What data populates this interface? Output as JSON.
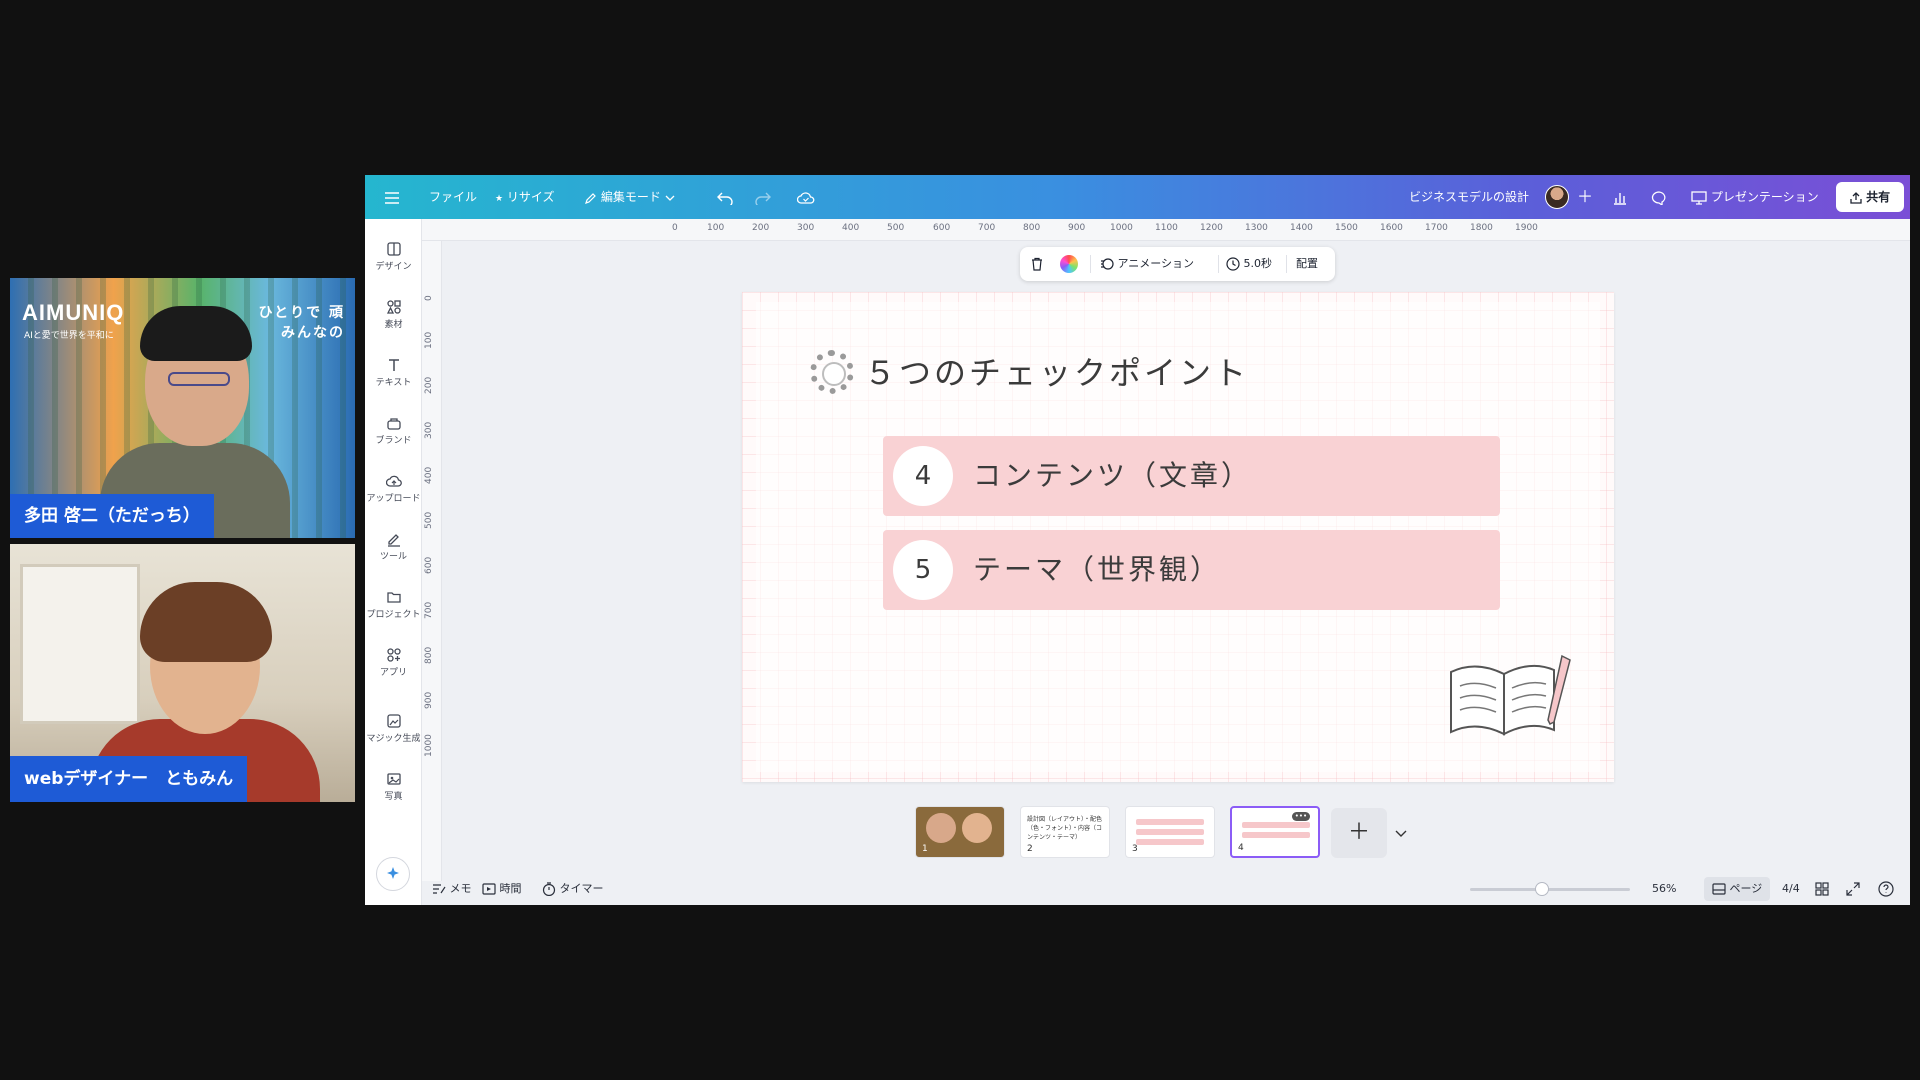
{
  "participants": [
    {
      "name": "多田 啓二（ただっち）",
      "background_brand": "AIMUNIQ",
      "background_brand_sub": "AIと愛で世界を平和に",
      "background_catch_line1": "ひとりで 頑",
      "background_catch_line2": "みんなの"
    },
    {
      "name": "webデザイナー　ともみん"
    }
  ],
  "topbar": {
    "file": "ファイル",
    "resize": "リサイズ",
    "edit_mode": "編集モード",
    "doc_title": "ビジネスモデルの設計",
    "present": "プレゼンテーション",
    "share": "共有"
  },
  "sidebar": {
    "items": [
      {
        "label": "デザイン",
        "icon": "design-icon"
      },
      {
        "label": "素材",
        "icon": "elements-icon"
      },
      {
        "label": "テキスト",
        "icon": "text-icon"
      },
      {
        "label": "ブランド",
        "icon": "brand-icon"
      },
      {
        "label": "アップロード",
        "icon": "upload-icon"
      },
      {
        "label": "ツール",
        "icon": "draw-icon"
      },
      {
        "label": "プロジェクト",
        "icon": "folder-icon"
      },
      {
        "label": "アプリ",
        "icon": "apps-icon"
      },
      {
        "label": "マジック生成",
        "icon": "magic-media-icon"
      },
      {
        "label": "写真",
        "icon": "photo-icon"
      }
    ]
  },
  "ruler": {
    "top": [
      "0",
      "100",
      "200",
      "300",
      "400",
      "500",
      "600",
      "700",
      "800",
      "900",
      "1000",
      "1100",
      "1200",
      "1300",
      "1400",
      "1500",
      "1600",
      "1700",
      "1800",
      "1900"
    ],
    "left": [
      "0",
      "100",
      "200",
      "300",
      "400",
      "500",
      "600",
      "700",
      "800",
      "900",
      "1000"
    ]
  },
  "element_toolbar": {
    "animation": "アニメーション",
    "duration": "5.0秒",
    "arrange": "配置"
  },
  "slide": {
    "title": "５つのチェックポイント",
    "points": [
      {
        "num": "4",
        "label": "コンテンツ（文章）"
      },
      {
        "num": "5",
        "label": "テーマ（世界観）"
      }
    ],
    "accent_color": "#f9d2d4"
  },
  "thumbnails": [
    {
      "page": "1"
    },
    {
      "page": "2",
      "text": "設計図（レイアウト）・配色（色・フォント）・内容（コンテンツ・テーマ）"
    },
    {
      "page": "3"
    },
    {
      "page": "4"
    }
  ],
  "bottombar": {
    "notes": "メモ",
    "duration": "時間",
    "timer": "タイマー",
    "zoom": "56%",
    "zoom_fraction": 0.45,
    "pages": "ページ",
    "page_count": "4/4"
  }
}
